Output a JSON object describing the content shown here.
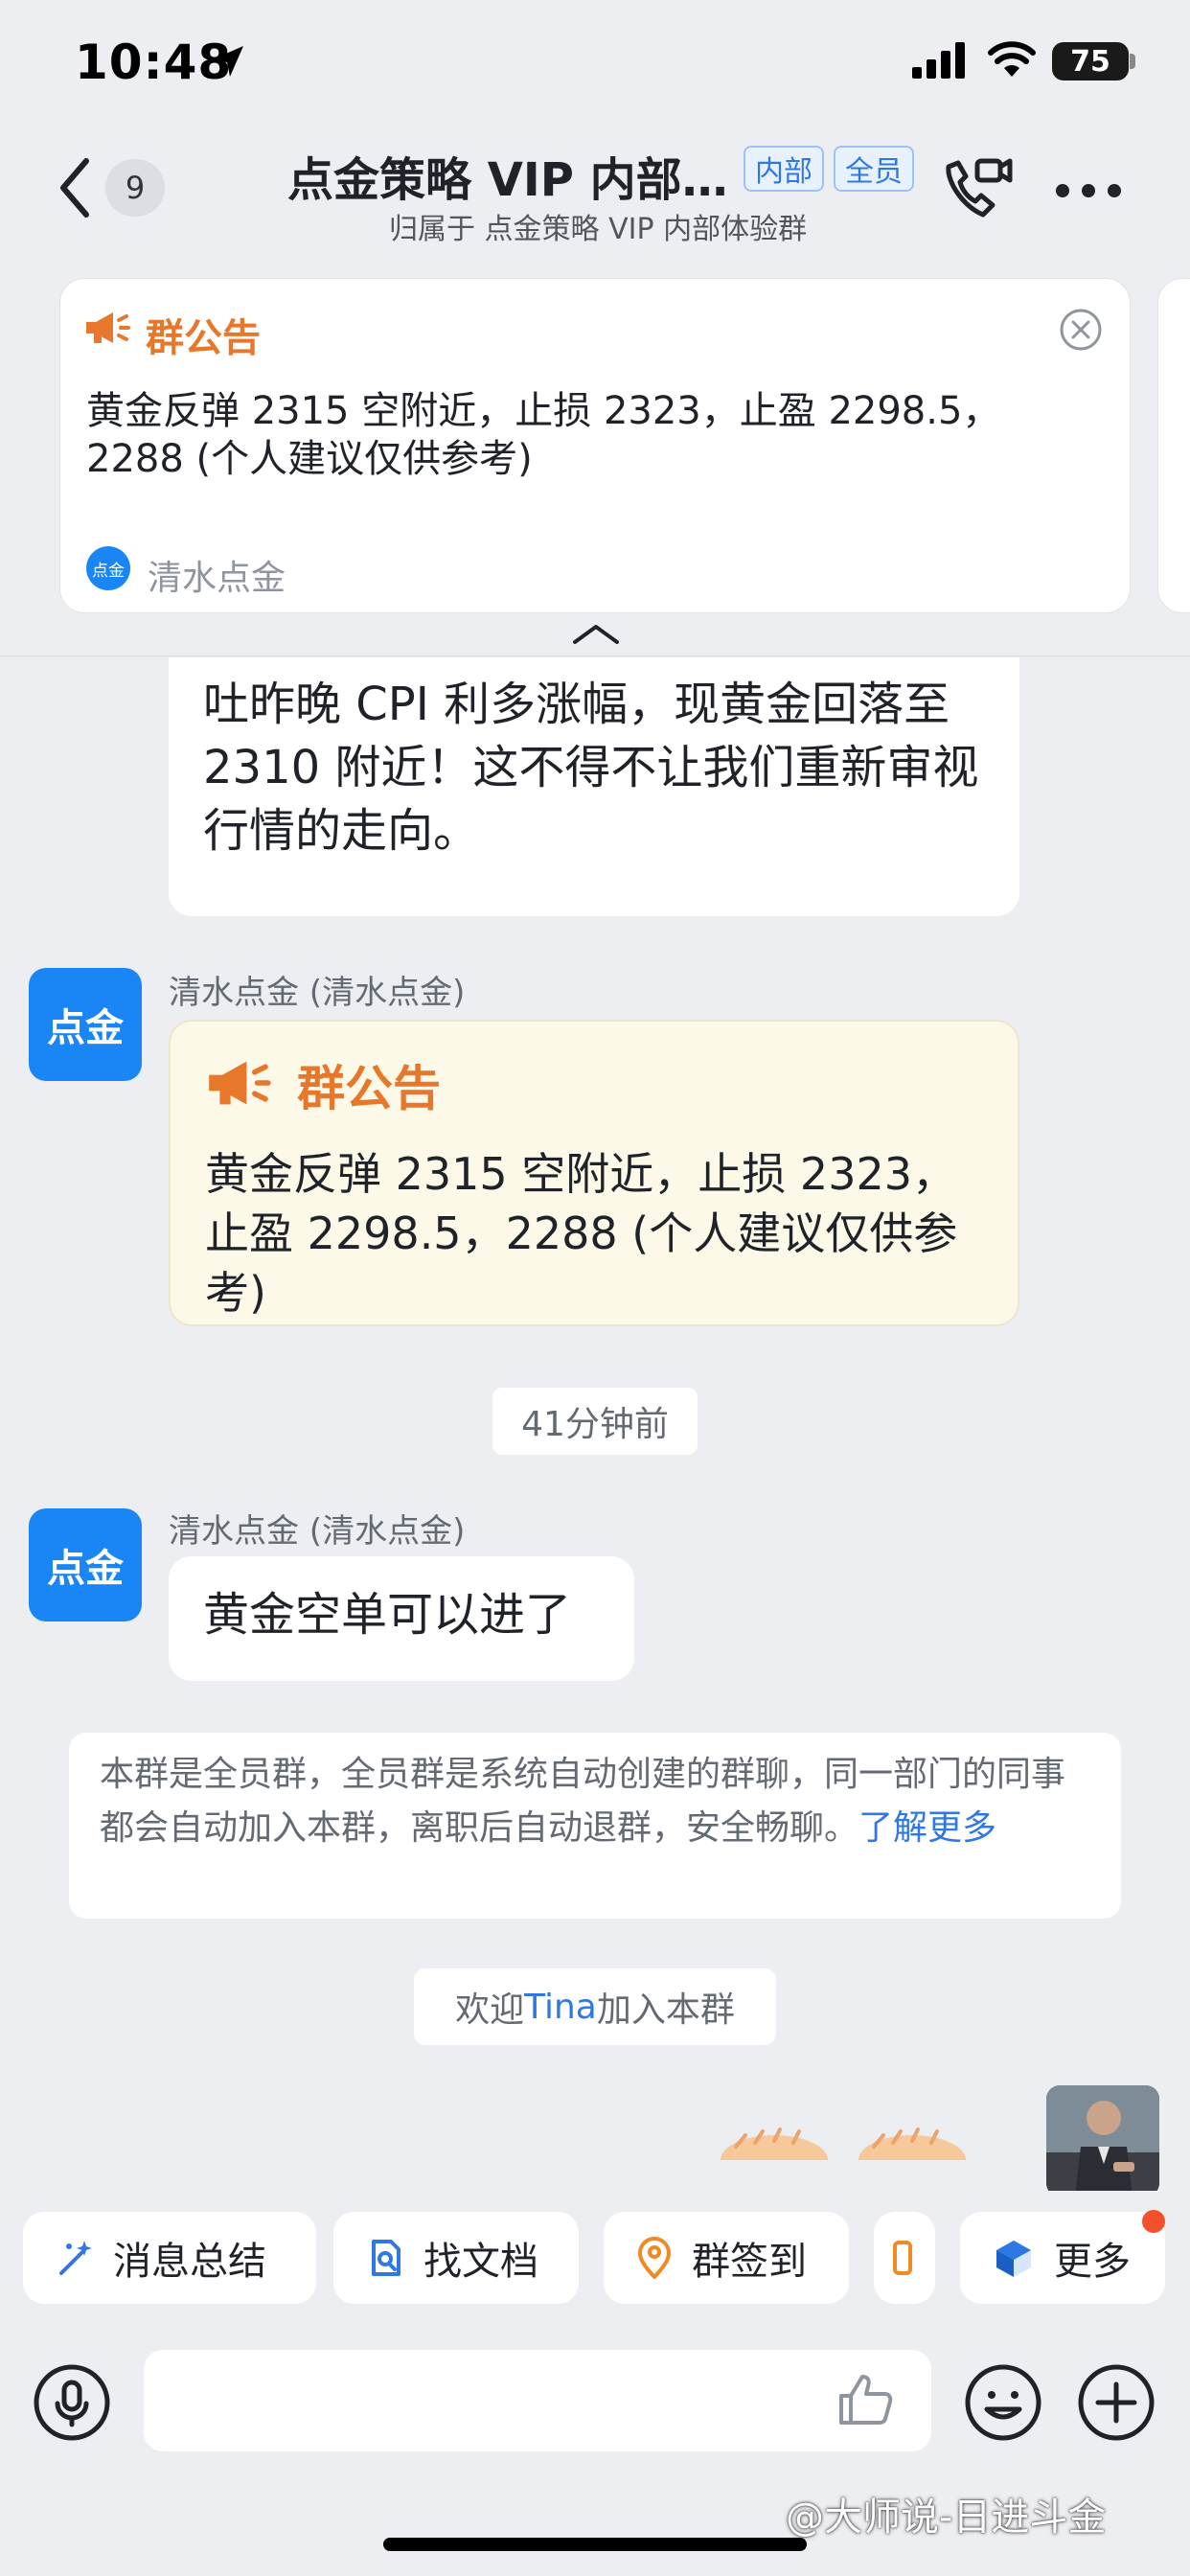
{
  "status_bar": {
    "time": "10:48",
    "battery": "75"
  },
  "header": {
    "back_badge": "9",
    "title": "点金策略 VIP 内部…",
    "tags": [
      "内部",
      "全员"
    ],
    "subtitle": "归属于 点金策略 VIP 内部体验群"
  },
  "pinned": {
    "title": "群公告",
    "text": "黄金反弹 2315 空附近，止损 2323，止盈 2298.5，2288 (个人建议仅供参考)",
    "avatar_text": "点金",
    "author": "清水点金"
  },
  "messages": {
    "partial_text": "吐昨晚 CPI 利多涨幅，现黄金回落至 2310 附近！这不得不让我们重新审视行情的走向。",
    "avatar_text": "点金",
    "sender": "清水点金 (清水点金)",
    "announcement_title": "群公告",
    "announcement_text": "黄金反弹 2315 空附近，止损 2323，止盈 2298.5，2288 (个人建议仅供参考)",
    "time_label": "41分钟前",
    "short_text": "黄金空单可以进了",
    "system_notice": "本群是全员群，全员群是系统自动创建的群聊，同一部门的同事都会自动加入本群，离职后自动退群，安全畅聊。",
    "system_link": "了解更多",
    "welcome_prefix": "欢迎 ",
    "welcome_name": "Tina",
    "welcome_suffix": " 加入本群"
  },
  "quick_actions": [
    "消息总结",
    "找文档",
    "群签到",
    "更多"
  ],
  "input": {
    "placeholder": ""
  },
  "watermark": "@大师说-日进斗金",
  "colors": {
    "accent_blue": "#1a86f5",
    "link_blue": "#2f78e3",
    "announcement_orange": "#e7782b",
    "background": "#edeef1"
  },
  "icons": [
    "location-arrow-icon",
    "signal-icon",
    "wifi-icon",
    "back-chevron-icon",
    "video-call-icon",
    "more-dots-icon",
    "megaphone-icon",
    "close-circle-icon",
    "collapse-chevron-icon",
    "sparkle-icon",
    "doc-search-icon",
    "location-pin-icon",
    "cube-icon",
    "mic-icon",
    "thumbs-up-icon",
    "emoji-icon",
    "plus-icon"
  ]
}
